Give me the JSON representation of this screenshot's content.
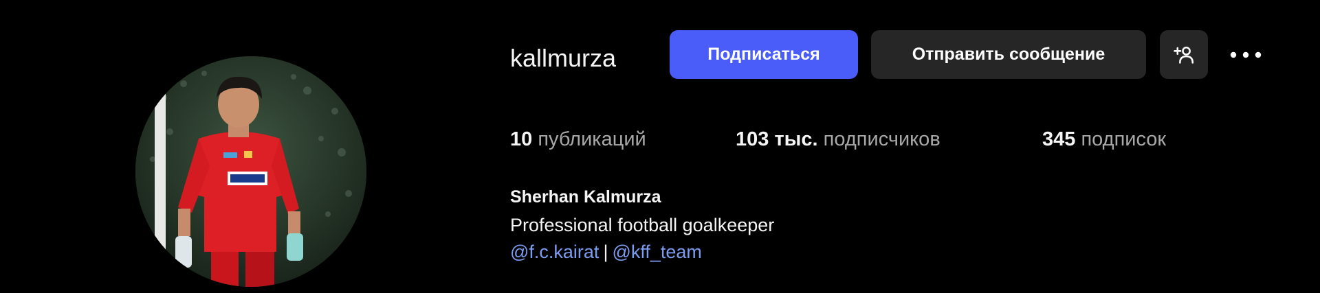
{
  "profile": {
    "username": "kallmurza",
    "full_name": "Sherhan Kalmurza",
    "bio": "Professional football goalkeeper",
    "bio_links": [
      {
        "text": "@f.c.kairat"
      },
      {
        "text": "@kff_team"
      }
    ],
    "bio_separator": "|",
    "avatar_icon": "profile-photo"
  },
  "actions": {
    "follow_label": "Подписаться",
    "message_label": "Отправить сообщение",
    "suggest_icon": "add-person-icon",
    "more_icon": "more-options-icon"
  },
  "stats": {
    "posts": {
      "value": "10",
      "label": "публикаций"
    },
    "followers": {
      "value": "103 тыс.",
      "label": "подписчиков"
    },
    "following": {
      "value": "345",
      "label": "подписок"
    }
  },
  "colors": {
    "background": "#000000",
    "primary_button": "#4a5df9",
    "secondary_button": "#262626",
    "link": "#7c9cf0",
    "muted_text": "#a8a8a8"
  }
}
